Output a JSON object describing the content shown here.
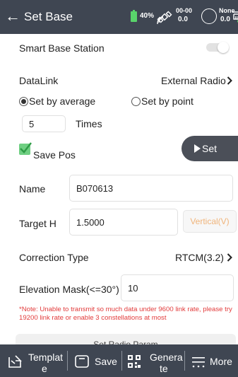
{
  "header": {
    "title": "Set Base",
    "battery_text": "40%",
    "sat_top": "00-00",
    "sat_bot": "0.0",
    "sol_top": "None",
    "sol_bot": "0.0"
  },
  "form": {
    "smart_base_label": "Smart Base Station",
    "smart_base_on": false,
    "datalink_label": "DataLink",
    "datalink_value": "External Radio",
    "radio_average_label": "Set by average",
    "radio_point_label": "Set by point",
    "radio_selected": "average",
    "times_value": "5",
    "times_label": "Times",
    "save_pos_label": "Save Pos",
    "save_pos_checked": true,
    "set_button": "Set",
    "name_label": "Name",
    "name_value": "B070613",
    "target_h_label": "Target H",
    "target_h_value": "1.5000",
    "vertical_button": "Vertical(V)",
    "correction_label": "Correction Type",
    "correction_value": "RTCM(3.2)",
    "elevation_label": "Elevation Mask(<=30°)",
    "elevation_value": "10",
    "note": "*Note: Unable to transmit so much data under 9600 link rate, please try 19200 link rate or enable 3 constellations at most",
    "partial_button": "Set Radio Param"
  },
  "bottom_bar": {
    "template_l1": "Templat",
    "template_l2": "e",
    "save": "Save",
    "generate_l1": "Genera",
    "generate_l2": "te",
    "more": "More"
  },
  "colors": {
    "header_bg": "#3f4652",
    "accent_green": "#6fcf82",
    "note_red": "#e23b3b",
    "vertical_text": "#f0b47a"
  }
}
